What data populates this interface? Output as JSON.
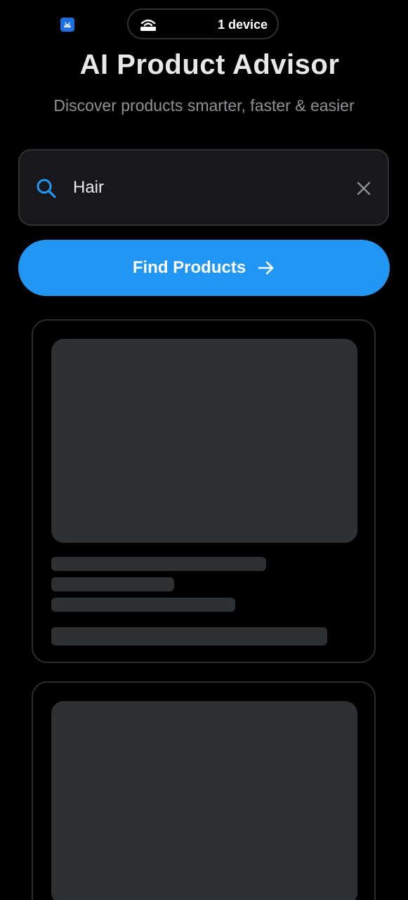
{
  "status": {
    "app_badge_icon": "app-icon",
    "hotspot_icon": "hotspot-icon",
    "device_count": "1 device"
  },
  "header": {
    "title": "AI Product Advisor",
    "subtitle": "Discover products smarter, faster & easier"
  },
  "search": {
    "value": "Hair",
    "icon": "search-icon",
    "clear_icon": "close-icon"
  },
  "find_button": {
    "label": "Find Products",
    "icon": "arrow-right-icon"
  },
  "colors": {
    "background": "#000000",
    "accent": "#2196f3",
    "skeleton": "#2e3134",
    "card_border": "#2a2d31"
  },
  "results": {
    "state": "loading",
    "skeleton_cards": 2
  }
}
